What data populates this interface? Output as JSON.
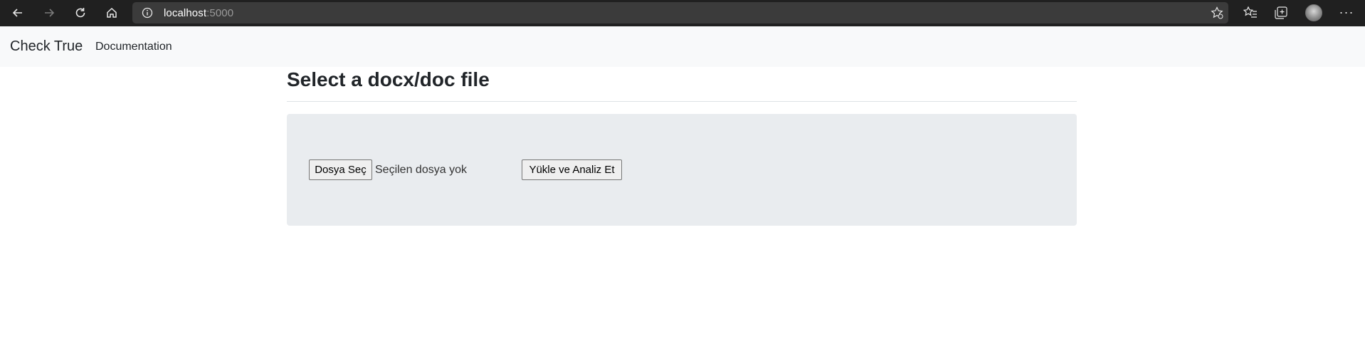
{
  "browser": {
    "url_host": "localhost",
    "url_port": ":5000",
    "icons": {
      "back": "back-arrow-icon",
      "forward": "forward-arrow-icon",
      "reload": "reload-icon",
      "home": "home-icon",
      "site_info": "info-icon",
      "add_favorite": "add-favorite-icon",
      "favorites": "favorites-icon",
      "collections": "collections-icon",
      "profile": "profile-avatar",
      "menu": "more-icon"
    },
    "more_label": "···"
  },
  "navbar": {
    "brand": "Check True",
    "links": [
      {
        "label": "Documentation"
      }
    ]
  },
  "main": {
    "title": "Select a docx/doc file",
    "upload_form": {
      "file_button_label": "Dosya Seç",
      "file_status": "Seçilen dosya yok",
      "submit_label": "Yükle ve Analiz Et"
    }
  },
  "colors": {
    "chrome_bg": "#202020",
    "address_bg": "#3b3b3b",
    "navbar_bg": "#f8f9fa",
    "panel_bg": "#e9ecef",
    "text": "#212529"
  }
}
